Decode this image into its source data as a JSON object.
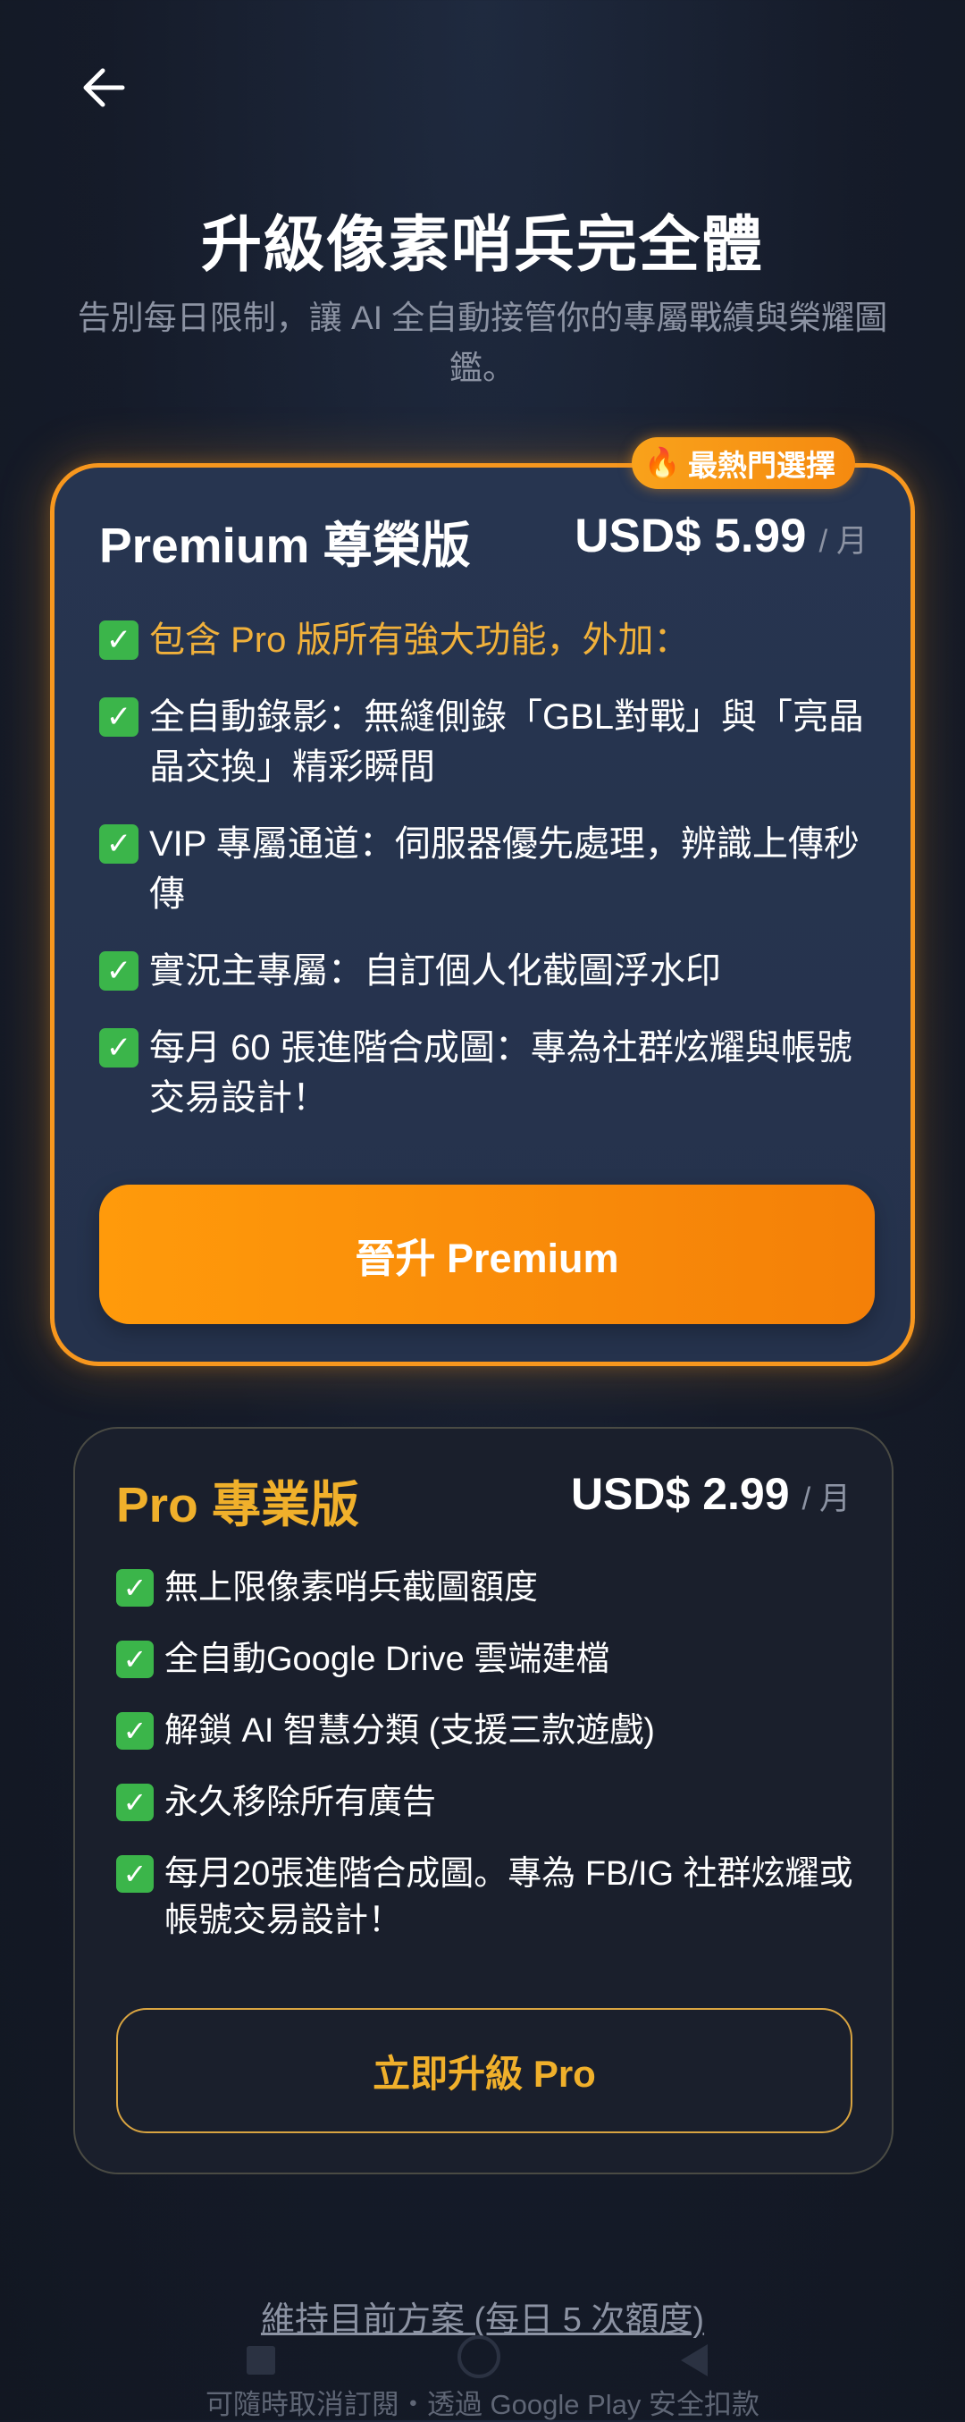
{
  "header": {
    "title": "升級像素哨兵完全體",
    "subtitle": "告別每日限制，讓 AI 全自動接管你的專屬戰績與榮耀圖鑑。"
  },
  "premium": {
    "badge_icon": "fire-icon",
    "badge_glyph": "🔥",
    "badge_label": "最熱門選擇",
    "name": "Premium 尊榮版",
    "price": "USD$ 5.99",
    "period": "/ 月",
    "check_glyph": "✓",
    "features": [
      "包含 Pro 版所有強大功能，外加：",
      "全自動錄影：無縫側錄「GBL對戰」與「亮晶晶交換」精彩瞬間",
      "VIP 專屬通道：伺服器優先處理，辨識上傳秒傳",
      "實況主專屬：自訂個人化截圖浮水印",
      "每月 60 張進階合成圖：專為社群炫耀與帳號交易設計！"
    ],
    "button_label": "晉升 Premium"
  },
  "pro": {
    "name": "Pro 專業版",
    "price": "USD$ 2.99",
    "period": "/ 月",
    "check_glyph": "✓",
    "features": [
      "無上限像素哨兵截圖額度",
      "全自動Google Drive 雲端建檔",
      "解鎖 AI 智慧分類 (支援三款遊戲)",
      "永久移除所有廣告",
      "每月20張進階合成圖。專為 FB/IG 社群炫耀或帳號交易設計！"
    ],
    "button_label": "立即升級 Pro"
  },
  "footer": {
    "keep_plan_link": "維持目前方案 (每日 5 次額度)",
    "note": "可隨時取消訂閱・透過 Google Play 安全扣款"
  },
  "colors": {
    "accent_orange": "#f7971e",
    "gold": "#f0b02b",
    "check_green": "#3bb54a",
    "background": "#151b29"
  }
}
